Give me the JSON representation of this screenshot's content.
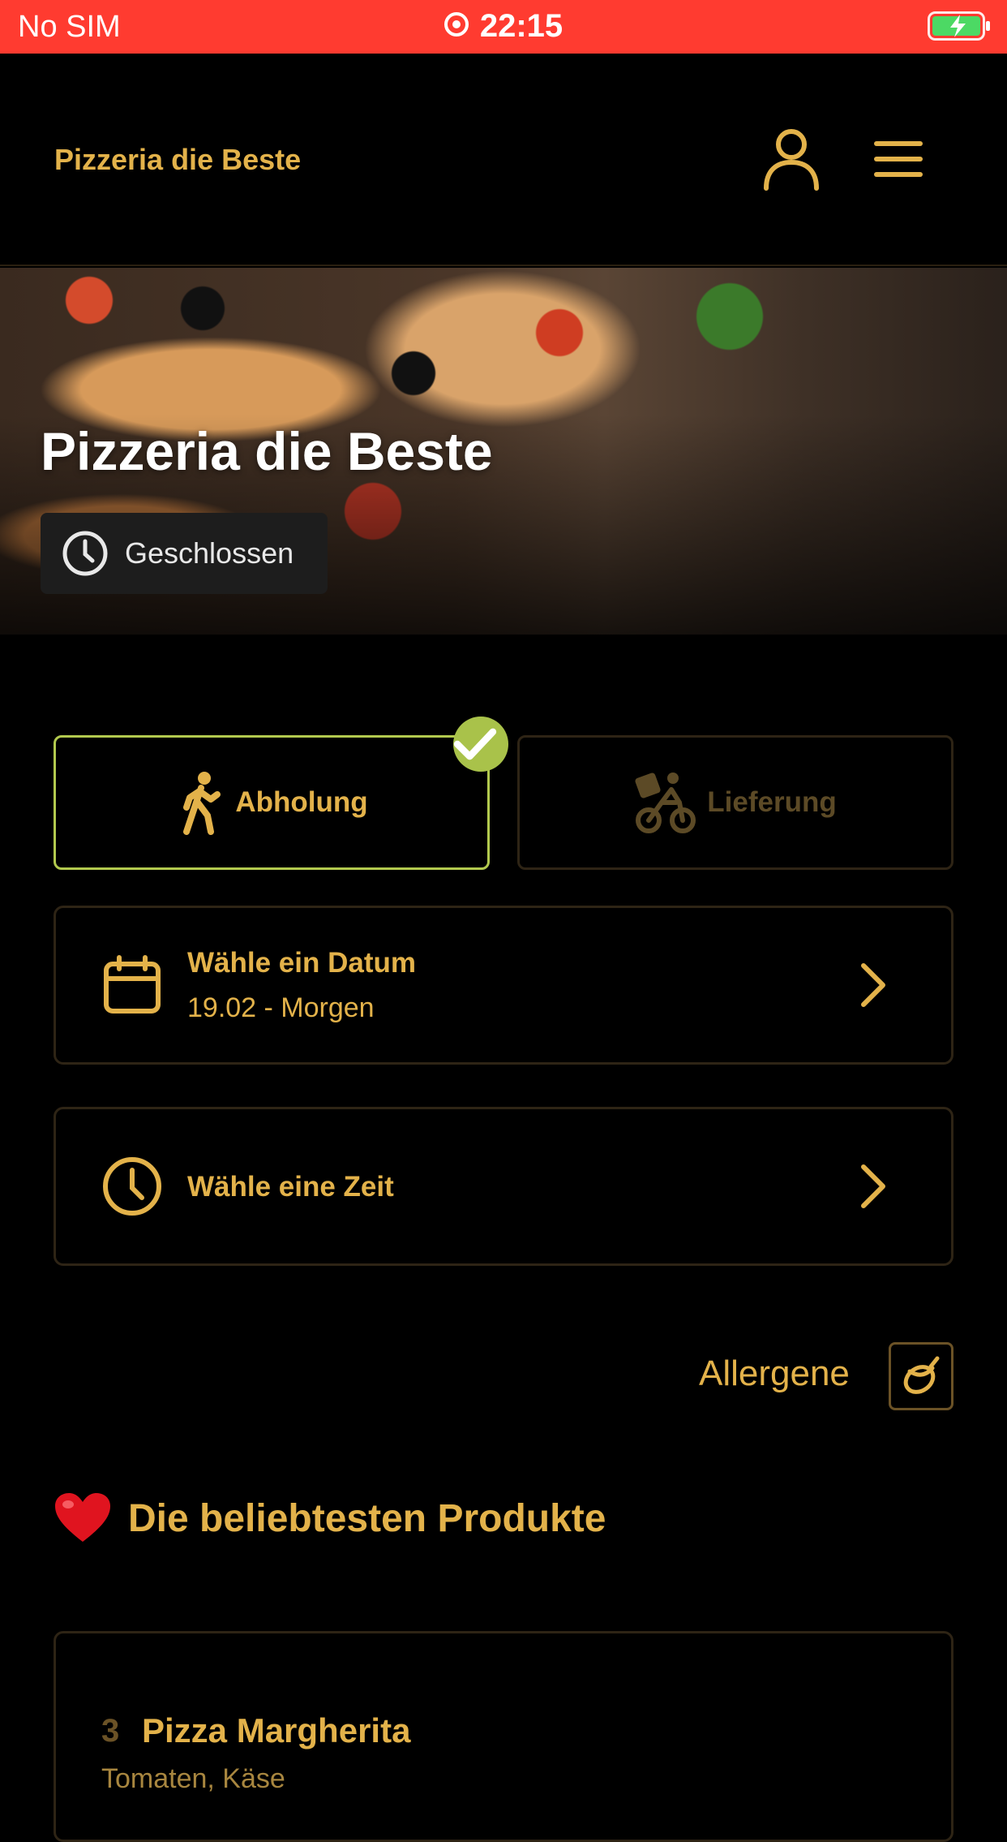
{
  "status_bar": {
    "carrier": "No SIM",
    "time": "22:15"
  },
  "header": {
    "brand": "Pizzeria die Beste",
    "icons": [
      "user-icon",
      "menu-icon"
    ]
  },
  "hero": {
    "title": "Pizzeria die Beste",
    "status": "Geschlossen"
  },
  "order_mode": {
    "pickup_label": "Abholung",
    "delivery_label": "Lieferung",
    "selected": "pickup"
  },
  "date_select": {
    "label": "Wähle ein Datum",
    "value": "19.02 - Morgen"
  },
  "time_select": {
    "label": "Wähle eine Zeit"
  },
  "allergens": {
    "label": "Allergene"
  },
  "popular": {
    "title": "Die beliebtesten Produkte",
    "products": [
      {
        "number": "3",
        "name": "Pizza Margherita",
        "description": "Tomaten, Käse"
      }
    ]
  },
  "colors": {
    "accent": "#e3b24a",
    "status_bar": "#ff3b30",
    "selected_border": "#b2c94e",
    "background": "#000000"
  }
}
